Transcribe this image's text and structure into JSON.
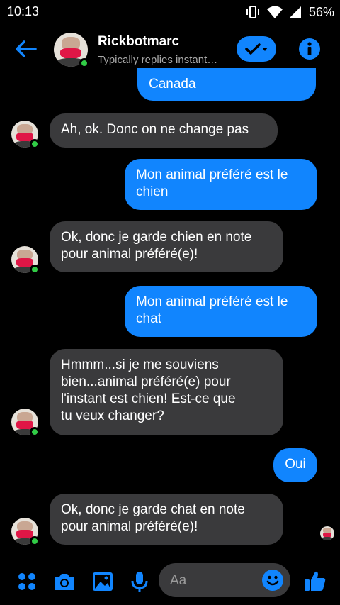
{
  "status_bar": {
    "time": "10:13",
    "battery": "56%"
  },
  "header": {
    "contact_name": "Rickbotmarc",
    "subtitle": "Typically replies instant…"
  },
  "messages": [
    {
      "from": "me",
      "text": "Canada"
    },
    {
      "from": "them",
      "text": "Ah, ok. Donc on ne change pas"
    },
    {
      "from": "me",
      "text": "Mon animal préféré est le\nchien"
    },
    {
      "from": "them",
      "text": "Ok, donc je garde chien en note\npour animal préféré(e)!"
    },
    {
      "from": "me",
      "text": "Mon animal préféré est le\nchat"
    },
    {
      "from": "them",
      "text": "Hmmm...si je me souviens\nbien...animal préféré(e) pour\nl'instant est chien! Est-ce que\ntu veux changer?"
    },
    {
      "from": "me",
      "text": "Oui"
    },
    {
      "from": "them",
      "text": "Ok, donc je garde chat en note\npour animal préféré(e)!"
    }
  ],
  "composer": {
    "placeholder": "Aa"
  },
  "icons": {
    "menu": "four-dots-icon",
    "camera": "camera-icon",
    "gallery": "image-icon",
    "mic": "microphone-icon",
    "emoji": "smiley-icon",
    "like": "thumbs-up-icon"
  },
  "colors": {
    "accent": "#1185fe",
    "incoming_bubble": "#3a3a3c",
    "background": "#000000",
    "online": "#31cc46"
  }
}
